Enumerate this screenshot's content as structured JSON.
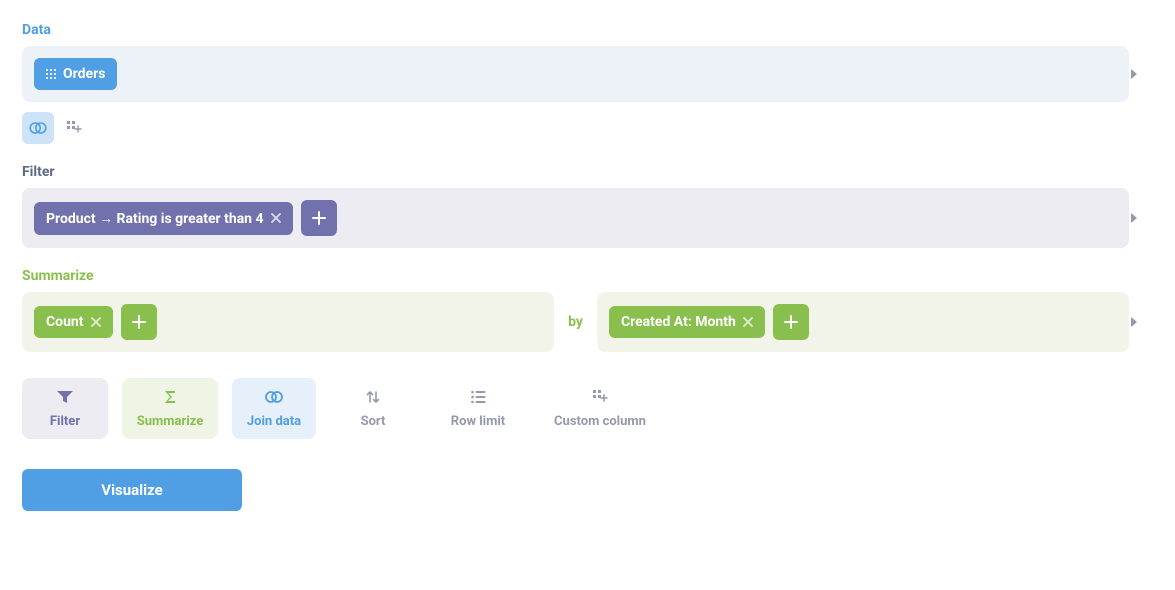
{
  "sections": {
    "data": {
      "label": "Data",
      "source_pill": "Orders"
    },
    "filter": {
      "label": "Filter",
      "pill": "Product → Rating is greater than 4"
    },
    "summarize": {
      "label": "Summarize",
      "aggregation_pill": "Count",
      "by_label": "by",
      "breakout_pill": "Created At: Month"
    }
  },
  "actions": {
    "filter": "Filter",
    "summarize": "Summarize",
    "join": "Join data",
    "sort": "Sort",
    "rowlimit": "Row limit",
    "customcol": "Custom column"
  },
  "visualize_label": "Visualize"
}
